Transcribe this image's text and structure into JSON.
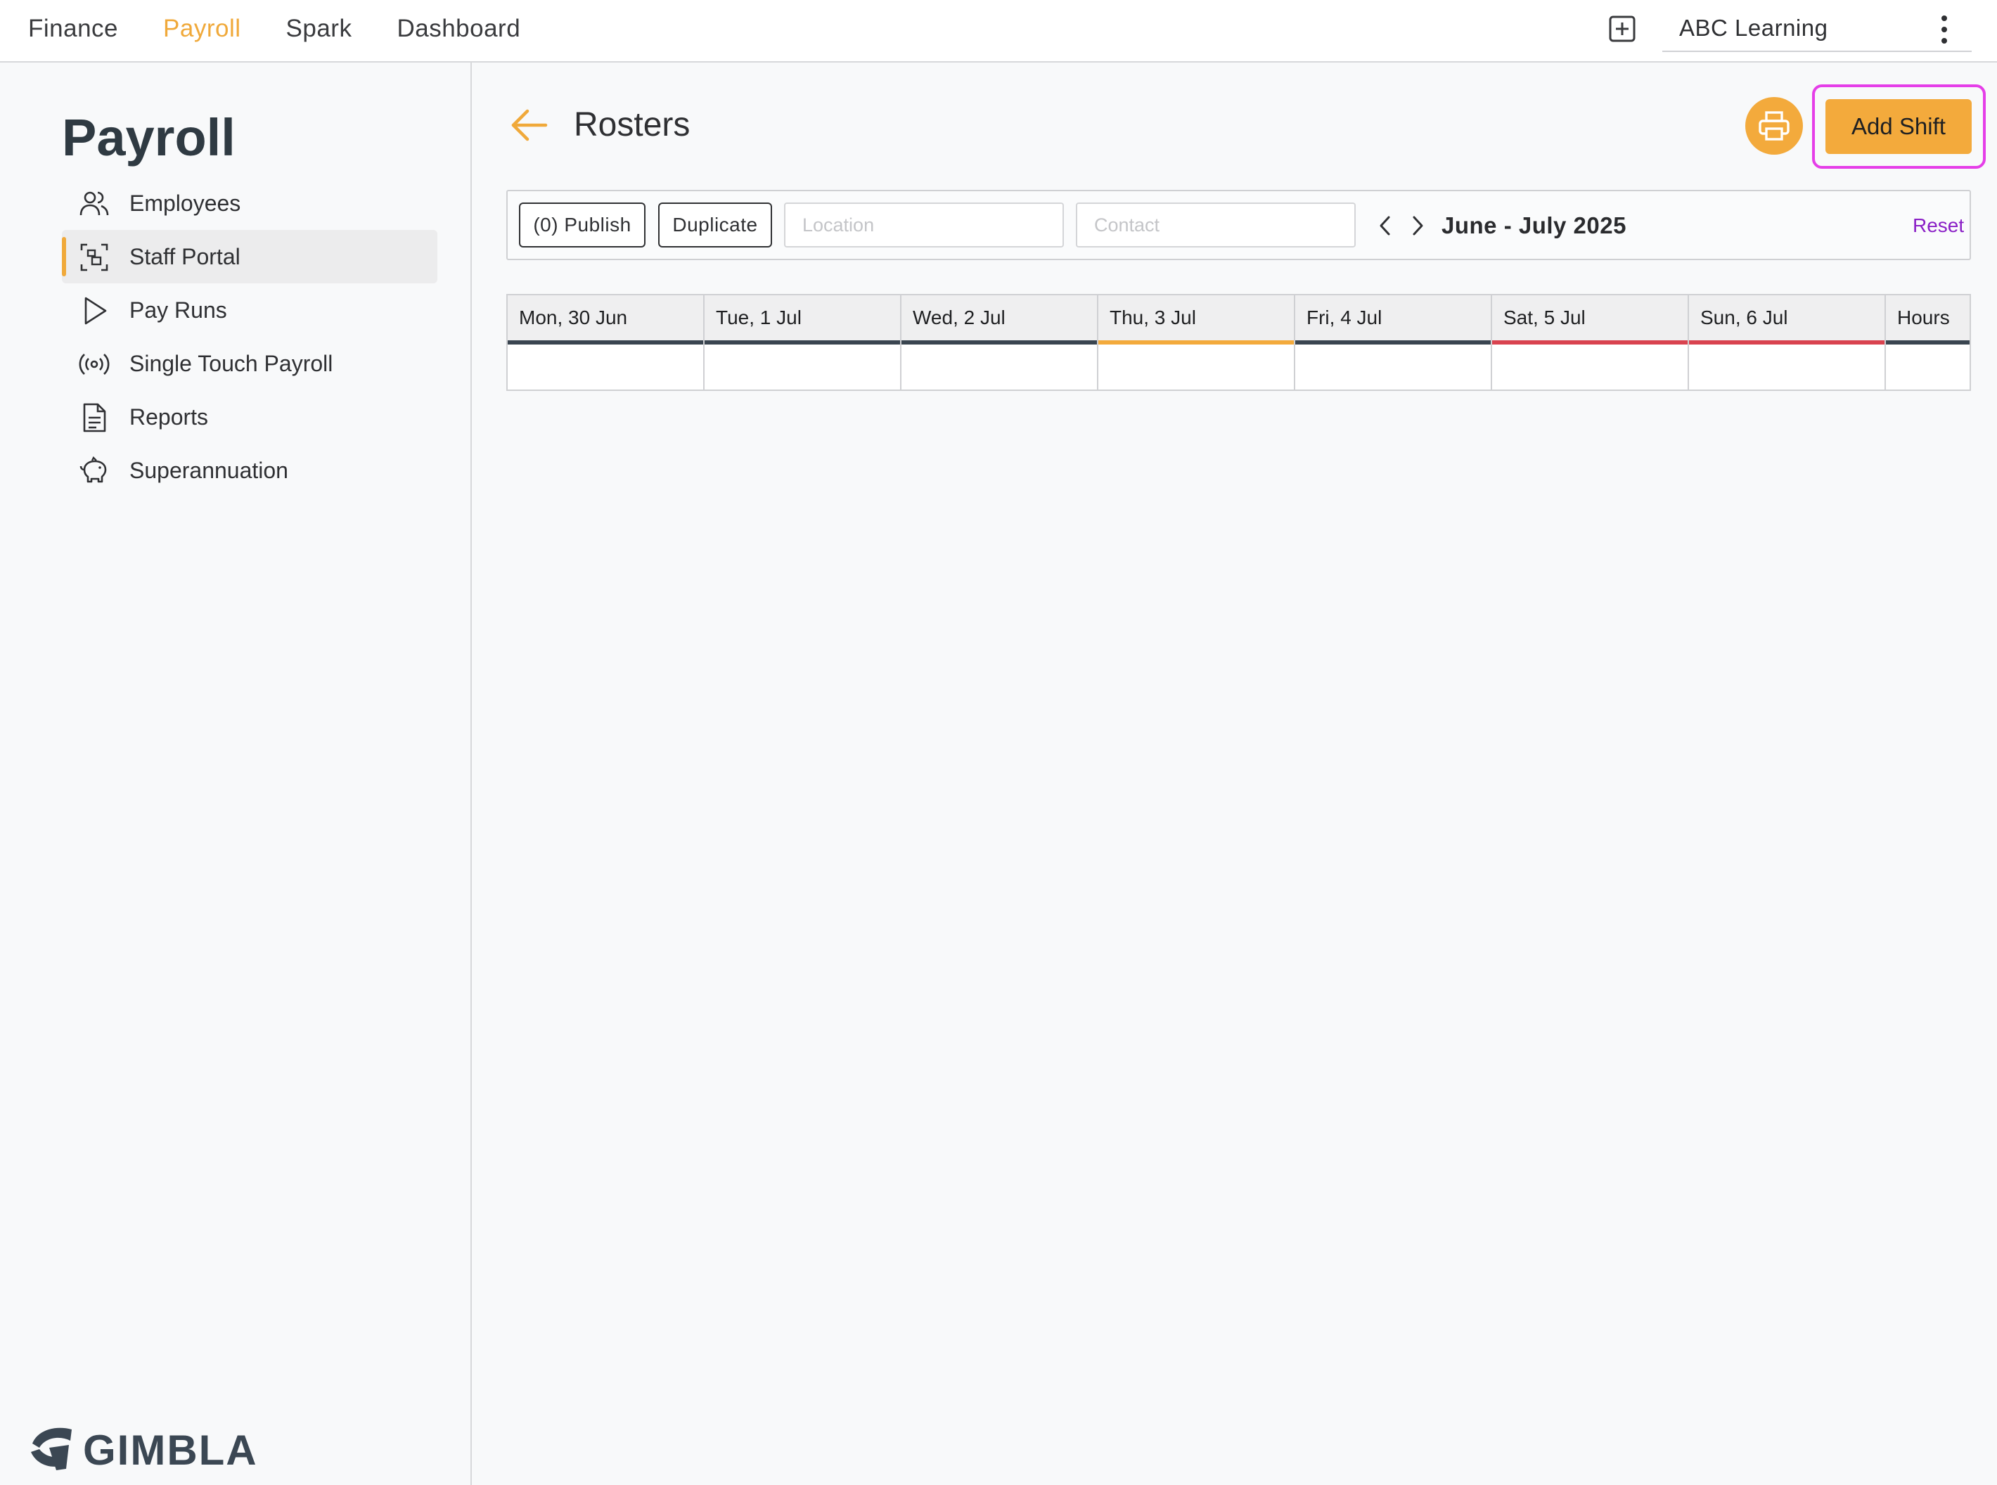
{
  "topnav": {
    "items": [
      {
        "label": "Finance",
        "active": false
      },
      {
        "label": "Payroll",
        "active": true
      },
      {
        "label": "Spark",
        "active": false
      },
      {
        "label": "Dashboard",
        "active": false
      }
    ],
    "organization": "ABC Learning",
    "add_icon": "plus-square-icon",
    "menu_icon": "kebab-menu-icon"
  },
  "sidebar": {
    "title": "Payroll",
    "items": [
      {
        "label": "Employees",
        "icon": "users-icon",
        "active": false
      },
      {
        "label": "Staff Portal",
        "icon": "portal-scan-icon",
        "active": true
      },
      {
        "label": "Pay Runs",
        "icon": "play-icon",
        "active": false
      },
      {
        "label": "Single Touch Payroll",
        "icon": "broadcast-icon",
        "active": false
      },
      {
        "label": "Reports",
        "icon": "document-icon",
        "active": false
      },
      {
        "label": "Superannuation",
        "icon": "piggy-bank-icon",
        "active": false
      }
    ],
    "logo_text": "GIMBLA"
  },
  "main": {
    "title": "Rosters",
    "add_shift_label": "Add Shift",
    "toolbar": {
      "publish_label": "(0) Publish",
      "duplicate_label": "Duplicate",
      "location_placeholder": "Location",
      "contact_placeholder": "Contact",
      "date_range": "June - July 2025",
      "reset_label": "Reset"
    },
    "roster_columns": [
      {
        "label": "Mon, 30 Jun",
        "marker": "default"
      },
      {
        "label": "Tue, 1 Jul",
        "marker": "default"
      },
      {
        "label": "Wed, 2 Jul",
        "marker": "default"
      },
      {
        "label": "Thu, 3 Jul",
        "marker": "today"
      },
      {
        "label": "Fri, 4 Jul",
        "marker": "default"
      },
      {
        "label": "Sat, 5 Jul",
        "marker": "weekend"
      },
      {
        "label": "Sun, 6 Jul",
        "marker": "weekend"
      },
      {
        "label": "Hours",
        "marker": "default"
      }
    ]
  },
  "colors": {
    "accent": "#f3aa3c",
    "highlight_outline": "#e53ee8",
    "reset_link": "#8a1fc6",
    "weekend_marker": "#d9434f",
    "default_marker": "#3a4550"
  }
}
